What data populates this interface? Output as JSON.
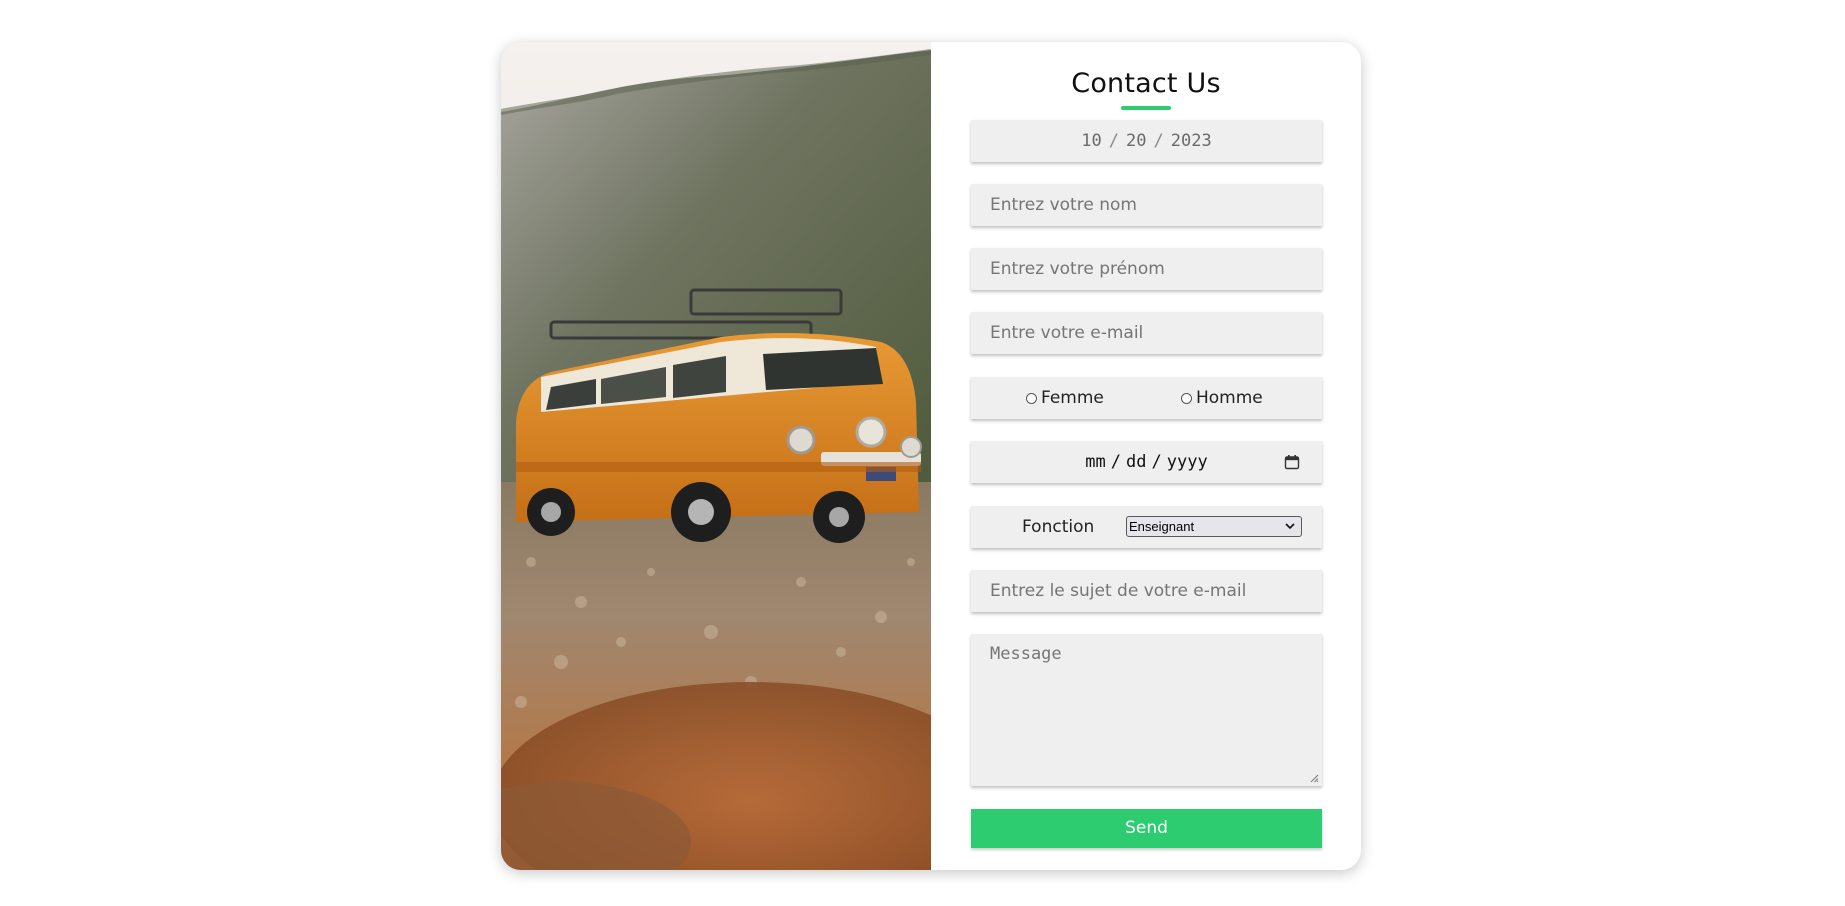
{
  "form": {
    "title": "Contact Us",
    "date_today": {
      "month": "10",
      "day": "20",
      "year": "2023",
      "sep": "/"
    },
    "nom_placeholder": "Entrez votre nom",
    "prenom_placeholder": "Entrez votre prénom",
    "email_placeholder": "Entre votre e-mail",
    "gender": {
      "female_label": "Femme",
      "male_label": "Homme"
    },
    "birthdate": {
      "month": "mm",
      "day": "dd",
      "year": "yyyy",
      "sep": "/"
    },
    "fonction_label": "Fonction",
    "fonction_selected": "Enseignant",
    "subject_placeholder": "Entrez le sujet de votre e-mail",
    "message_placeholder": "Message",
    "send_label": "Send"
  },
  "colors": {
    "accent": "#2ecc71",
    "field_bg": "#efefef",
    "van_orange": "#d98522"
  },
  "icons": {
    "calendar": "calendar-icon",
    "select_chevron": "chevron-down-icon",
    "textarea_resize": "resize-grip-icon"
  },
  "photo": {
    "subject": "orange-vw-camper-van"
  }
}
